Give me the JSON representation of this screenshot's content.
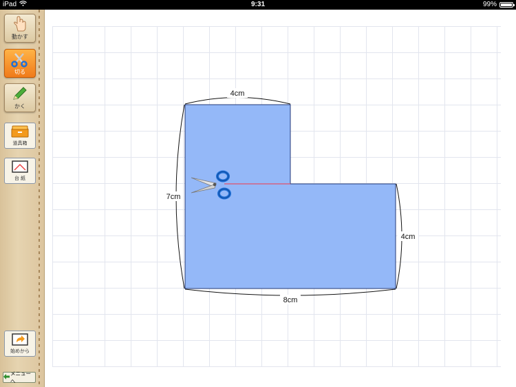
{
  "status": {
    "device": "iPad",
    "time": "9:31",
    "battery": "99%",
    "battery_level": 0.99
  },
  "sidebar": {
    "tools": [
      {
        "label": "動かす",
        "icon": "hand-icon"
      },
      {
        "label": "切る",
        "icon": "scissors-icon",
        "active": true
      },
      {
        "label": "かく",
        "icon": "pencil-icon"
      }
    ],
    "toolbox_label": "道具箱",
    "board_label": "台 紙",
    "restart_label": "始めから",
    "menu_label": "メニューへ"
  },
  "canvas": {
    "shape_color": "#94b8f8",
    "cut_line_color": "#e0506a",
    "dims": {
      "top": "4cm",
      "left": "7cm",
      "right": "4cm",
      "bottom": "8cm"
    }
  }
}
